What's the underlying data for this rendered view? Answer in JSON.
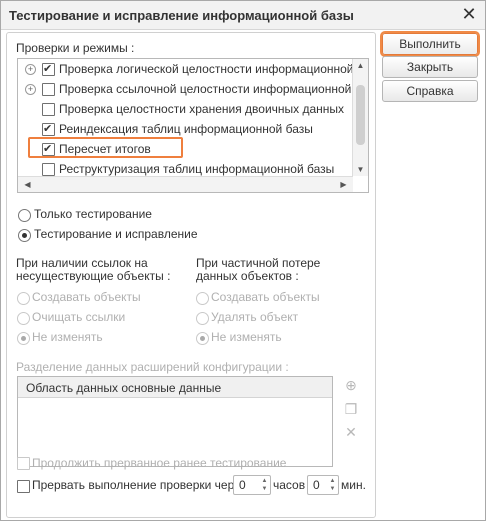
{
  "window": {
    "title": "Тестирование и исправление информационной базы"
  },
  "buttons": {
    "run": "Выполнить",
    "close": "Закрыть",
    "help": "Справка"
  },
  "checks": {
    "label": "Проверки и режимы :",
    "items": [
      {
        "label": "Проверка логической целостности информационной базы",
        "checked": true,
        "expandable": true
      },
      {
        "label": "Проверка ссылочной целостности информационной базы",
        "checked": false,
        "expandable": true
      },
      {
        "label": "Проверка целостности хранения двоичных данных",
        "checked": false,
        "expandable": false
      },
      {
        "label": "Реиндексация таблиц информационной базы",
        "checked": true,
        "expandable": false
      },
      {
        "label": "Пересчет итогов",
        "checked": true,
        "expandable": false,
        "highlighted": true
      },
      {
        "label": "Реструктуризация таблиц информационной базы",
        "checked": false,
        "expandable": false
      }
    ]
  },
  "mode": {
    "options": [
      {
        "label": "Только тестирование",
        "selected": false
      },
      {
        "label": "Тестирование и исправление",
        "selected": true
      }
    ]
  },
  "refs": {
    "left_label_line1": "При наличии ссылок на",
    "left_label_line2": "несуществующие объекты :",
    "left_options": [
      {
        "label": "Создавать объекты",
        "selected": false
      },
      {
        "label": "Очищать ссылки",
        "selected": false
      },
      {
        "label": "Не изменять",
        "selected": true
      }
    ],
    "right_label_line1": "При частичной потере",
    "right_label_line2": "данных объектов :",
    "right_options": [
      {
        "label": "Создавать объекты",
        "selected": false
      },
      {
        "label": "Удалять объект",
        "selected": false
      },
      {
        "label": "Не изменять",
        "selected": true
      }
    ]
  },
  "extensions": {
    "label": "Разделение данных расширений конфигурации :",
    "column": "Область данных основные данные"
  },
  "continue": {
    "label": "Продолжить прерванное ранее тестирование",
    "checked": false
  },
  "interrupt": {
    "label": "Прервать выполнение проверки через",
    "hours_value": "0",
    "hours_label": "часов",
    "minutes_value": "0",
    "minutes_label": "мин."
  },
  "icons": [
    "close-icon",
    "expand-icon",
    "scroll-up-icon",
    "scroll-down-icon",
    "scroll-left-icon",
    "scroll-right-icon",
    "add-icon",
    "copy-icon",
    "delete-icon",
    "spin-up-icon",
    "spin-down-icon"
  ]
}
